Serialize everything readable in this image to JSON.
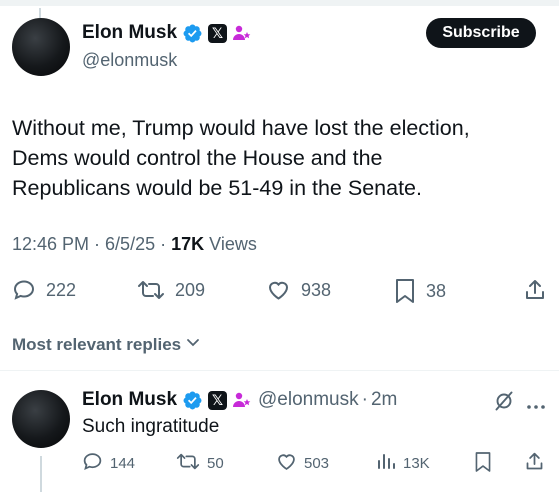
{
  "tweet": {
    "author_name": "Elon Musk",
    "x_badge": "𝕏",
    "handle": "@elonmusk",
    "subscribe_label": "Subscribe",
    "text_lines": [
      "Without me, Trump would have lost the election,",
      "Dems would control the House and the",
      "Republicans would be 51-49 in the Senate."
    ],
    "time": "12:46 PM",
    "date": "6/5/25",
    "views_count": "17K",
    "views_label": "Views",
    "stats": {
      "replies": "222",
      "reposts": "209",
      "likes": "938",
      "bookmarks": "38"
    }
  },
  "replies_sort": {
    "label": "Most relevant replies"
  },
  "reply": {
    "author_name": "Elon Musk",
    "x_badge": "𝕏",
    "handle": "@elonmusk",
    "age": "2m",
    "text": "Such ingratitude",
    "stats": {
      "replies": "144",
      "reposts": "50",
      "likes": "503",
      "views": "13K"
    }
  },
  "colors": {
    "verified": "#1d9bf0",
    "affiliate_badge": "#c72ad8",
    "muted": "#536471",
    "text": "#0f1419"
  },
  "icons": [
    "verified-badge-icon",
    "x-affiliate-icon",
    "affiliate-person-icon",
    "reply-icon",
    "repost-icon",
    "like-icon",
    "bookmark-icon",
    "share-icon",
    "views-icon",
    "grok-icon",
    "more-icon",
    "chevron-down-icon"
  ]
}
